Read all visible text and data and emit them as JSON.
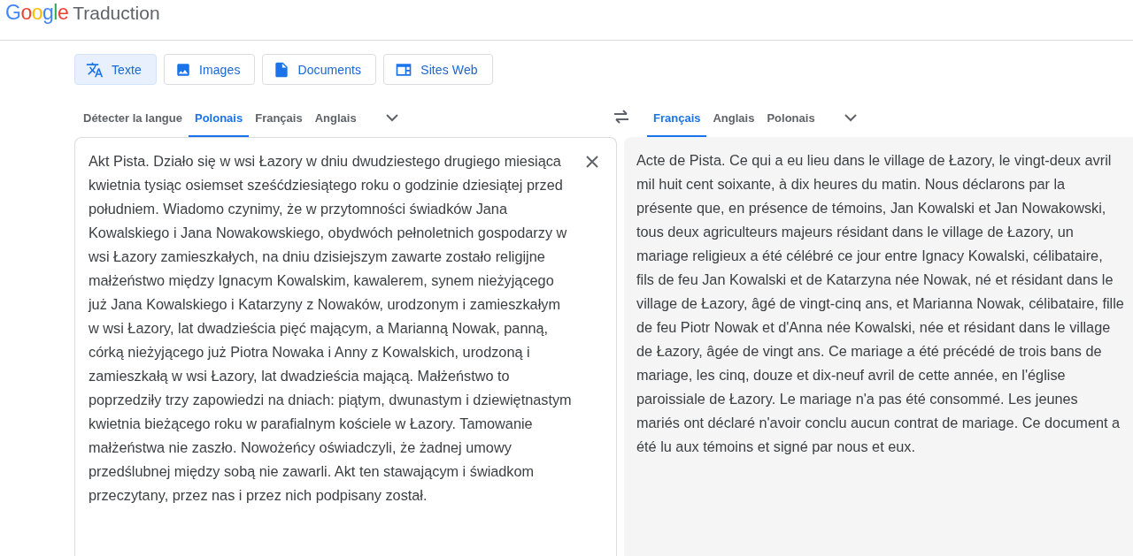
{
  "header": {
    "logo": "Google",
    "title": "Traduction"
  },
  "modes": [
    {
      "kind": "text",
      "label": "Texte",
      "selected": true
    },
    {
      "kind": "images",
      "label": "Images",
      "selected": false
    },
    {
      "kind": "documents",
      "label": "Documents",
      "selected": false
    },
    {
      "kind": "websites",
      "label": "Sites Web",
      "selected": false
    }
  ],
  "source_languages": [
    {
      "label": "Détecter la langue",
      "selected": false
    },
    {
      "label": "Polonais",
      "selected": true
    },
    {
      "label": "Français",
      "selected": false
    },
    {
      "label": "Anglais",
      "selected": false
    }
  ],
  "target_languages": [
    {
      "label": "Français",
      "selected": true
    },
    {
      "label": "Anglais",
      "selected": false
    },
    {
      "label": "Polonais",
      "selected": false
    }
  ],
  "source_text": "Akt Pista. Działo się w wsi Łazory w dniu dwudziestego drugiego miesiąca kwietnia tysiąc osiemset sześćdziesiątego roku o godzinie dziesiątej przed południem. Wiadomo czynimy, że w przytomności świadków Jana Kowalskiego i Jana Nowakowskiego, obydwóch pełnoletnich gospodarzy w wsi Łazory zamieszkałych, na dniu dzisiejszym zawarte zostało religijne małżeństwo między Ignacym Kowalskim, kawalerem, synem nieżyjącego już Jana Kowalskiego i Katarzyny z Nowaków, urodzonym i zamieszkałym w wsi Łazory, lat dwadzieścia pięć mającym, a Marianną Nowak, panną, córką nieżyjącego już Piotra Nowaka i Anny z Kowalskich, urodzoną i zamieszkałą w wsi Łazory, lat dwadzieścia mającą. Małżeństwo to poprzedziły trzy zapowiedzi na dniach: piątym, dwunastym i dziewiętnastym kwietnia bieżącego roku w parafialnym kościele w Łazory. Tamowanie małżeństwa nie zaszło. Nowożeńcy oświadczyli, że żadnej umowy przedślubnej między sobą nie zawarli. Akt ten stawającym i świadkom przeczytany, przez nas i przez nich podpisany został.",
  "translation": "Acte de Pista. Ce qui a eu lieu dans le village de Łazory, le vingt-deux avril mil huit cent soixante, à dix heures du matin. Nous déclarons par la présente que, en présence de témoins, Jan Kowalski et Jan Nowakowski, tous deux agriculteurs majeurs résidant dans le village de Łazory, un mariage religieux a été célébré ce jour entre Ignacy Kowalski, célibataire, fils de feu Jan Kowalski et de Katarzyna née Nowak, né et résidant dans le village de Łazory, âgé de vingt-cinq ans, et Marianna Nowak, célibataire, fille de feu Piotr Nowak et d'Anna née Kowalski, née et résidant dans le village de Łazory, âgée de vingt ans. Ce mariage a été précédé de trois bans de mariage, les cinq, douze et dix-neuf avril de cette année, en l'église paroissiale de Łazory. Le mariage n'a pas été consommé. Les jeunes mariés ont déclaré n'avoir conclu aucun contrat de mariage. Ce document a été lu aux témoins et signé par nous et eux."
}
